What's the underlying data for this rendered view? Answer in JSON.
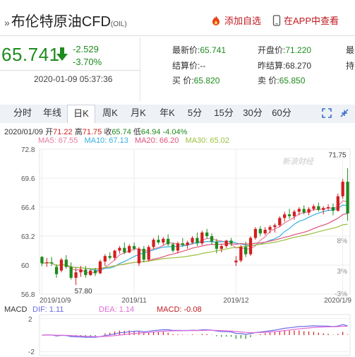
{
  "header": {
    "title": "布伦特原油CFD",
    "title_code": "(OIL)",
    "add_favorite": "添加自选",
    "view_in_app": "在APP中查看"
  },
  "quote": {
    "price": "65.741",
    "change": "-2.529",
    "change_pct": "-3.70%",
    "timestamp": "2020-01-09 05:37:36",
    "latest_label": "最新价:",
    "latest_value": "65.741",
    "settle_label": "结算价:",
    "settle_value": "--",
    "bid_label": "买  价:",
    "bid_value": "65.820",
    "open_label": "开盘价:",
    "open_value": "71.220",
    "prev_label": "昨结算:",
    "prev_value": "68.270",
    "ask_label": "卖  价:",
    "ask_value": "65.850",
    "col3_r1": "最",
    "col3_r2": "持"
  },
  "tabs": [
    "分时",
    "年线",
    "日K",
    "周K",
    "月K",
    "年K",
    "5分",
    "15分",
    "30分",
    "60分"
  ],
  "active_tab": "日K",
  "ohlc": {
    "date": "2020/01/09",
    "open_label": "开",
    "open": "71.22",
    "high_label": "高",
    "high": "71.75",
    "close_label": "收",
    "close": "65.74",
    "low_label": "低",
    "low": "64.94",
    "pct": "-4.04%"
  },
  "ma": {
    "ma5": "MA5: 67.55",
    "ma10": "MA10: 67.13",
    "ma20": "MA20: 66.20",
    "ma30": "MA30: 65.02"
  },
  "colors": {
    "up": "#d21f1f",
    "down": "#1e8b1e",
    "ma5": "#e67aa0",
    "ma10": "#35b0e0",
    "ma20": "#e0507a",
    "ma30": "#9cc03c",
    "dif": "#6a6ae8",
    "dea": "#e06ad8"
  },
  "watermark": "新浪财经",
  "chart_data": {
    "type": "candlestick",
    "y_ticks": [
      "72.8",
      "69.6",
      "66.4",
      "63.2",
      "60",
      "56.8"
    ],
    "pct_ticks": [
      "8%",
      "3%",
      "-3%"
    ],
    "x_ticks": [
      "2019/10/9",
      "2019/11",
      "2019/12",
      "2020/1/9"
    ],
    "ylim": [
      56.8,
      72.8
    ],
    "high_label": "71.75",
    "low_label": "57.80",
    "candles": [
      [
        60.9,
        61.0,
        59.9,
        60.2
      ],
      [
        60.2,
        60.8,
        59.8,
        60.3
      ],
      [
        60.3,
        60.9,
        59.9,
        60.2
      ],
      [
        59.8,
        60.1,
        58.6,
        59.0
      ],
      [
        59.4,
        60.8,
        59.2,
        60.6
      ],
      [
        60.6,
        61.1,
        59.6,
        59.8
      ],
      [
        59.8,
        60.3,
        58.4,
        58.6
      ],
      [
        58.6,
        59.7,
        57.8,
        59.2
      ],
      [
        59.2,
        59.9,
        58.7,
        59.5
      ],
      [
        59.5,
        59.9,
        58.6,
        58.9
      ],
      [
        58.9,
        59.5,
        58.8,
        59.4
      ],
      [
        59.4,
        59.7,
        58.8,
        59.1
      ],
      [
        59.1,
        60.6,
        59.0,
        60.4
      ],
      [
        60.4,
        61.2,
        59.9,
        61.0
      ],
      [
        61.0,
        61.4,
        60.6,
        60.8
      ],
      [
        60.8,
        61.7,
        60.5,
        61.6
      ],
      [
        61.6,
        62.1,
        61.3,
        61.9
      ],
      [
        61.9,
        62.5,
        61.2,
        61.4
      ],
      [
        61.4,
        62.3,
        61.3,
        62.1
      ],
      [
        62.1,
        62.5,
        61.6,
        61.8
      ],
      [
        60.2,
        62.0,
        59.9,
        61.8
      ],
      [
        61.8,
        62.1,
        60.3,
        60.6
      ],
      [
        60.6,
        62.2,
        60.4,
        62.0
      ],
      [
        62.0,
        63.0,
        61.8,
        62.8
      ],
      [
        62.8,
        63.3,
        62.3,
        62.5
      ],
      [
        62.5,
        63.1,
        62.2,
        62.9
      ],
      [
        62.9,
        63.4,
        62.1,
        62.3
      ],
      [
        62.3,
        62.5,
        61.4,
        61.6
      ],
      [
        61.6,
        62.6,
        61.3,
        62.4
      ],
      [
        62.4,
        63.0,
        62.0,
        62.2
      ],
      [
        62.2,
        62.7,
        61.8,
        62.5
      ],
      [
        62.5,
        63.2,
        62.3,
        63.0
      ],
      [
        63.0,
        63.6,
        62.1,
        62.4
      ],
      [
        62.4,
        63.8,
        62.2,
        63.6
      ],
      [
        63.6,
        64.0,
        62.9,
        63.2
      ],
      [
        63.2,
        63.5,
        62.3,
        62.6
      ],
      [
        62.6,
        62.9,
        61.3,
        61.8
      ],
      [
        61.8,
        62.3,
        61.4,
        62.1
      ],
      [
        62.1,
        62.8,
        61.9,
        62.7
      ],
      [
        62.7,
        63.0,
        62.1,
        62.4
      ],
      [
        60.3,
        61.0,
        59.9,
        60.5
      ],
      [
        60.5,
        62.2,
        60.3,
        62.0
      ],
      [
        62.0,
        62.6,
        60.9,
        61.2
      ],
      [
        61.2,
        63.2,
        61.0,
        63.0
      ],
      [
        63.0,
        64.2,
        62.8,
        64.0
      ],
      [
        64.0,
        64.3,
        63.2,
        63.5
      ],
      [
        63.5,
        64.2,
        63.3,
        63.9
      ],
      [
        63.9,
        64.4,
        63.5,
        64.2
      ],
      [
        64.2,
        64.6,
        63.6,
        64.4
      ],
      [
        64.4,
        65.4,
        64.2,
        65.2
      ],
      [
        65.2,
        65.9,
        64.8,
        65.6
      ],
      [
        65.6,
        66.2,
        65.1,
        65.4
      ],
      [
        65.4,
        66.1,
        65.0,
        65.9
      ],
      [
        65.9,
        66.4,
        65.5,
        66.2
      ],
      [
        66.2,
        66.6,
        65.6,
        65.8
      ],
      [
        65.8,
        66.4,
        65.5,
        66.2
      ],
      [
        66.2,
        66.7,
        66.0,
        66.5
      ],
      [
        66.5,
        66.9,
        65.9,
        66.1
      ],
      [
        66.1,
        66.5,
        65.6,
        66.3
      ],
      [
        66.3,
        66.7,
        66.0,
        66.4
      ],
      [
        66.4,
        66.8,
        65.5,
        66.0
      ],
      [
        66.0,
        67.9,
        65.9,
        67.6
      ],
      [
        67.6,
        69.5,
        67.3,
        69.2
      ],
      [
        69.2,
        70.7,
        64.9,
        65.7
      ]
    ],
    "macd": {
      "labels": {
        "macd": "MACD",
        "dif": "DIF: 1.11",
        "dea": "DEA: 1.14",
        "macd_val": "MACD: -0.08"
      },
      "y_ticks": [
        "2",
        "-2"
      ],
      "ylim": [
        -2.5,
        2.5
      ]
    }
  }
}
